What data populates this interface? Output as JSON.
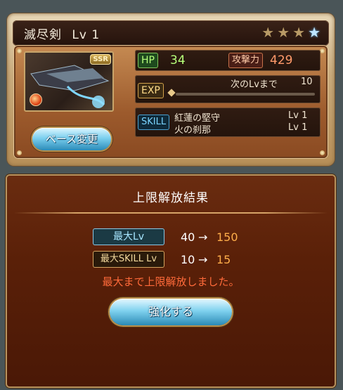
{
  "weapon": {
    "name": "滅尽剣",
    "level_label": "Lv 1",
    "rarity_badge": "SSR",
    "element_icon": "fire-element-icon",
    "stars": [
      "star-icon",
      "star-icon",
      "star-icon",
      "star-blue-icon"
    ]
  },
  "stats": {
    "hp_label": "HP",
    "hp_value": "34",
    "atk_label": "攻撃力",
    "atk_value": "429",
    "exp_label": "EXP",
    "exp_next_label": "次のLvまで",
    "exp_next_value": "10",
    "skill_label": "SKILL",
    "skills": [
      {
        "name": "紅蓮の堅守",
        "level": "Lv 1"
      },
      {
        "name": "火の刹那",
        "level": "Lv 1"
      }
    ]
  },
  "buttons": {
    "base_change": "ベース変更",
    "enhance": "強化する"
  },
  "result": {
    "title": "上限解放結果",
    "max_lv_label": "最大Lv",
    "max_lv_old": "40",
    "max_lv_new": "150",
    "max_skill_lv_label": "最大SKILL Lv",
    "max_skill_lv_old": "10",
    "max_skill_lv_new": "15",
    "arrow": "→",
    "notice": "最大まで上限解放しました。"
  },
  "colors": {
    "hp": "#b6ff7a",
    "atk": "#ff9a6a",
    "skill_label": "#7ad4ff",
    "notice": "#ff6a3a",
    "new_value": "#ffae4a"
  }
}
